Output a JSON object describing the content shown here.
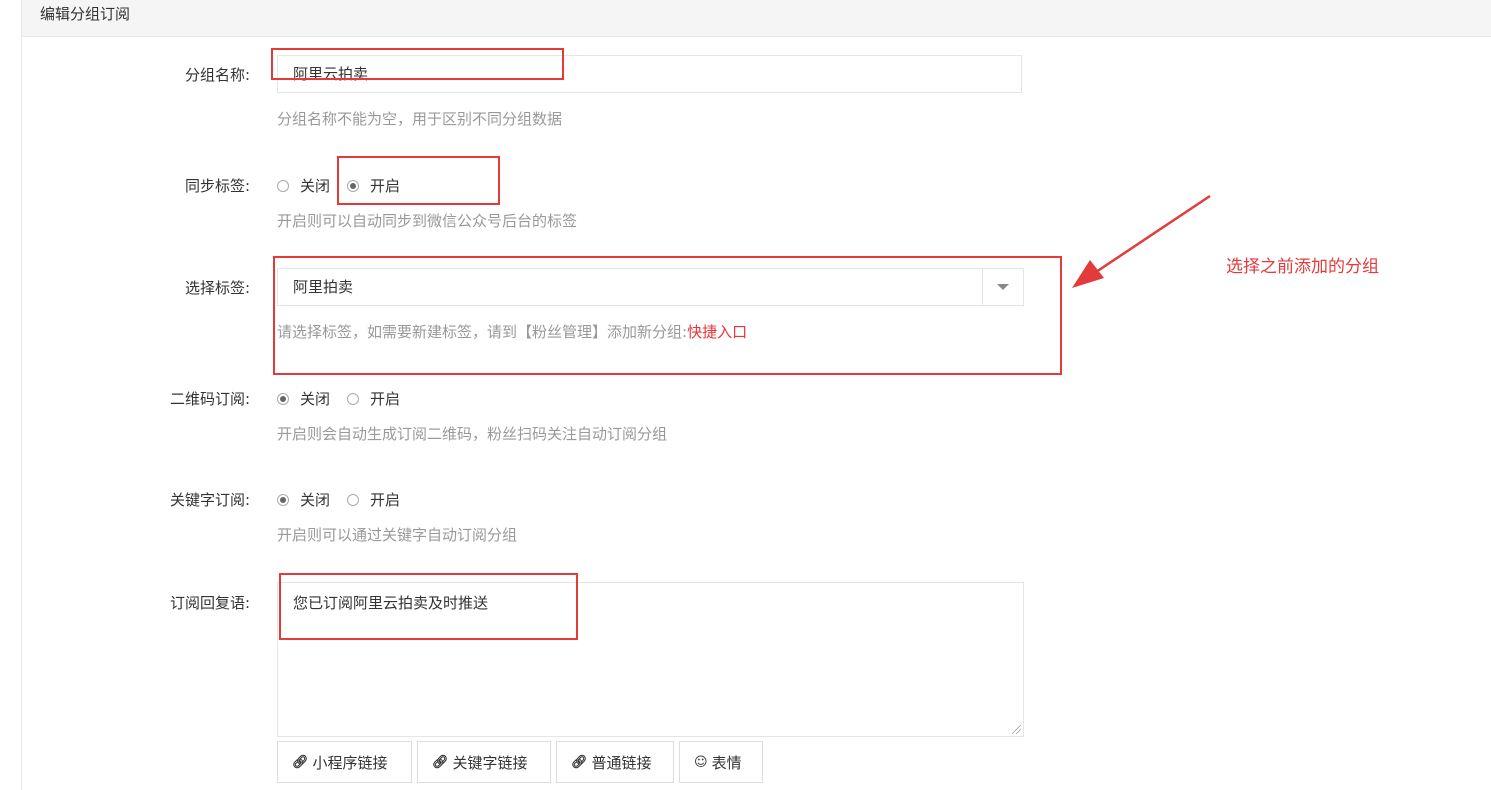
{
  "panel_title": "编辑分组订阅",
  "group_name": {
    "label": "分组名称:",
    "value": "阿里云拍卖",
    "help": "分组名称不能为空，用于区别不同分组数据"
  },
  "sync_tag": {
    "label": "同步标签:",
    "options": [
      "关闭",
      "开启"
    ],
    "selected": "开启",
    "help": "开启则可以自动同步到微信公众号后台的标签"
  },
  "select_tag": {
    "label": "选择标签:",
    "value": "阿里拍卖",
    "help": "请选择标签，如需要新建标签，请到【粉丝管理】添加新分组:",
    "help_link": "快捷入口"
  },
  "qr_subscribe": {
    "label": "二维码订阅:",
    "options": [
      "关闭",
      "开启"
    ],
    "selected": "关闭",
    "help": "开启则会自动生成订阅二维码，粉丝扫码关注自动订阅分组"
  },
  "keyword_subscribe": {
    "label": "关键字订阅:",
    "options": [
      "关闭",
      "开启"
    ],
    "selected": "关闭",
    "help": "开启则可以通过关键字自动订阅分组"
  },
  "reply": {
    "label": "订阅回复语:",
    "value": "您已订阅阿里云拍卖及时推送"
  },
  "buttons": {
    "miniprogram_link": "小程序链接",
    "keyword_link": "关键字链接",
    "normal_link": "普通链接",
    "emoji": "表情"
  },
  "annotation": {
    "text": "选择之前添加的分组",
    "color": "#e33b3b"
  }
}
